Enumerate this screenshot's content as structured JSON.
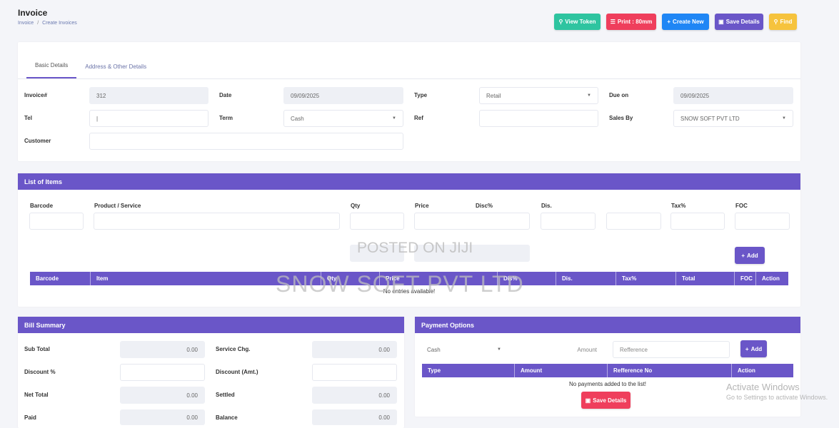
{
  "header": {
    "title": "Invoice",
    "breadcrumb": [
      "Invoice",
      "/",
      "Create Invoices"
    ],
    "buttons": {
      "view_token": "View Token",
      "print": "Print : 80mm",
      "create_new": "Create New",
      "save_details": "Save Details",
      "find": "Find"
    }
  },
  "tabs": [
    "Basic Details",
    "Address & Other Details"
  ],
  "basic": {
    "invoice_label": "Invoice#",
    "invoice_value": "312",
    "date_label": "Date",
    "date_value": "09/09/2025",
    "type_label": "Type",
    "type_value": "Retail",
    "due_label": "Due on",
    "due_value": "09/09/2025",
    "tel_label": "Tel",
    "tel_value": "|",
    "term_label": "Term",
    "term_value": "Cash",
    "ref_label": "Ref",
    "ref_value": "",
    "sales_label": "Sales By",
    "sales_value": "SNOW SOFT PVT LTD",
    "customer_label": "Customer",
    "customer_value": ""
  },
  "items": {
    "title": "List of Items",
    "entry_labels": [
      "Barcode",
      "Product / Service",
      "Qty",
      "Price",
      "Disc%",
      "Dis.",
      "Tax%",
      "FOC"
    ],
    "add_label": "Add",
    "columns": [
      "Barcode",
      "Item",
      "Qty",
      "Price",
      "Dis%",
      "Dis.",
      "Tax%",
      "Total",
      "FOC",
      "Action"
    ],
    "empty_text": "No entries available!"
  },
  "bill": {
    "title": "Bill Summary",
    "sub_total_label": "Sub Total",
    "sub_total_value": "0.00",
    "service_label": "Service Chg.",
    "service_value": "0.00",
    "discount_pct_label": "Discount %",
    "discount_pct_value": "",
    "discount_amt_label": "Discount (Amt.)",
    "discount_amt_value": "",
    "net_total_label": "Net Total",
    "net_total_value": "0.00",
    "settled_label": "Settled",
    "settled_value": "0.00",
    "paid_label": "Paid",
    "paid_value": "0.00",
    "balance_label": "Balance",
    "balance_value": "0.00"
  },
  "payment": {
    "title": "Payment Options",
    "method_value": "Cash",
    "amount_placeholder": "Amount",
    "reference_placeholder": "Refference",
    "add_label": "Add",
    "columns": [
      "Type",
      "Amount",
      "Refference No",
      "Action"
    ],
    "empty_text": "No payments added to the list!",
    "save_label": "Save Details"
  },
  "watermark": {
    "posted": "POSTED ON JIJI",
    "company": "SNOW SOFT PVT LTD"
  },
  "activation": {
    "line1": "Activate Windows",
    "line2": "Go to Settings to activate Windows."
  },
  "colors": {
    "primary": "#6a56c8",
    "teal": "#2ec4a0",
    "red": "#ef3e5c",
    "blue": "#1f86f5",
    "yellow": "#f6c33d"
  }
}
